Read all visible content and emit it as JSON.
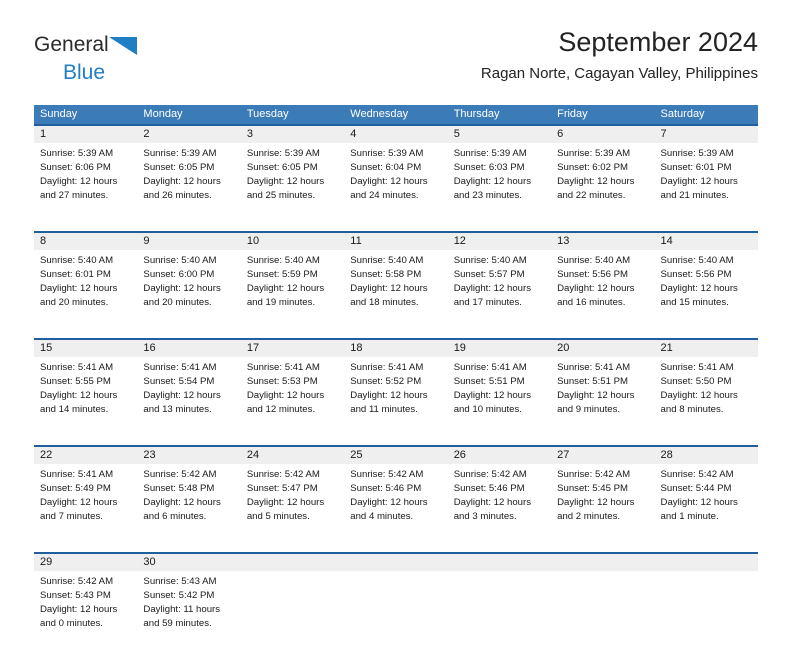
{
  "brand": {
    "name_part1": "General",
    "name_part2": "Blue",
    "triangle_icon": "blue-triangle-icon",
    "colors": {
      "text": "#2b2b2b",
      "blue": "#1f7ec4"
    }
  },
  "header": {
    "title": "September 2024",
    "subtitle": "Ragan Norte, Cagayan Valley, Philippines"
  },
  "theme": {
    "header_blue": "#3b7cb8",
    "separator_blue": "#1f5f9e",
    "daynum_band": "#efefef",
    "text": "#1a1a1a"
  },
  "weekdays": [
    "Sunday",
    "Monday",
    "Tuesday",
    "Wednesday",
    "Thursday",
    "Friday",
    "Saturday"
  ],
  "labels": {
    "sunrise_prefix": "Sunrise:",
    "sunset_prefix": "Sunset:",
    "daylight_prefix": "Daylight:"
  },
  "weeks": [
    {
      "days": [
        {
          "num": "1",
          "sunrise": "Sunrise: 5:39 AM",
          "sunset": "Sunset: 6:06 PM",
          "daylight_l1": "Daylight: 12 hours",
          "daylight_l2": "and 27 minutes."
        },
        {
          "num": "2",
          "sunrise": "Sunrise: 5:39 AM",
          "sunset": "Sunset: 6:05 PM",
          "daylight_l1": "Daylight: 12 hours",
          "daylight_l2": "and 26 minutes."
        },
        {
          "num": "3",
          "sunrise": "Sunrise: 5:39 AM",
          "sunset": "Sunset: 6:05 PM",
          "daylight_l1": "Daylight: 12 hours",
          "daylight_l2": "and 25 minutes."
        },
        {
          "num": "4",
          "sunrise": "Sunrise: 5:39 AM",
          "sunset": "Sunset: 6:04 PM",
          "daylight_l1": "Daylight: 12 hours",
          "daylight_l2": "and 24 minutes."
        },
        {
          "num": "5",
          "sunrise": "Sunrise: 5:39 AM",
          "sunset": "Sunset: 6:03 PM",
          "daylight_l1": "Daylight: 12 hours",
          "daylight_l2": "and 23 minutes."
        },
        {
          "num": "6",
          "sunrise": "Sunrise: 5:39 AM",
          "sunset": "Sunset: 6:02 PM",
          "daylight_l1": "Daylight: 12 hours",
          "daylight_l2": "and 22 minutes."
        },
        {
          "num": "7",
          "sunrise": "Sunrise: 5:39 AM",
          "sunset": "Sunset: 6:01 PM",
          "daylight_l1": "Daylight: 12 hours",
          "daylight_l2": "and 21 minutes."
        }
      ]
    },
    {
      "days": [
        {
          "num": "8",
          "sunrise": "Sunrise: 5:40 AM",
          "sunset": "Sunset: 6:01 PM",
          "daylight_l1": "Daylight: 12 hours",
          "daylight_l2": "and 20 minutes."
        },
        {
          "num": "9",
          "sunrise": "Sunrise: 5:40 AM",
          "sunset": "Sunset: 6:00 PM",
          "daylight_l1": "Daylight: 12 hours",
          "daylight_l2": "and 20 minutes."
        },
        {
          "num": "10",
          "sunrise": "Sunrise: 5:40 AM",
          "sunset": "Sunset: 5:59 PM",
          "daylight_l1": "Daylight: 12 hours",
          "daylight_l2": "and 19 minutes."
        },
        {
          "num": "11",
          "sunrise": "Sunrise: 5:40 AM",
          "sunset": "Sunset: 5:58 PM",
          "daylight_l1": "Daylight: 12 hours",
          "daylight_l2": "and 18 minutes."
        },
        {
          "num": "12",
          "sunrise": "Sunrise: 5:40 AM",
          "sunset": "Sunset: 5:57 PM",
          "daylight_l1": "Daylight: 12 hours",
          "daylight_l2": "and 17 minutes."
        },
        {
          "num": "13",
          "sunrise": "Sunrise: 5:40 AM",
          "sunset": "Sunset: 5:56 PM",
          "daylight_l1": "Daylight: 12 hours",
          "daylight_l2": "and 16 minutes."
        },
        {
          "num": "14",
          "sunrise": "Sunrise: 5:40 AM",
          "sunset": "Sunset: 5:56 PM",
          "daylight_l1": "Daylight: 12 hours",
          "daylight_l2": "and 15 minutes."
        }
      ]
    },
    {
      "days": [
        {
          "num": "15",
          "sunrise": "Sunrise: 5:41 AM",
          "sunset": "Sunset: 5:55 PM",
          "daylight_l1": "Daylight: 12 hours",
          "daylight_l2": "and 14 minutes."
        },
        {
          "num": "16",
          "sunrise": "Sunrise: 5:41 AM",
          "sunset": "Sunset: 5:54 PM",
          "daylight_l1": "Daylight: 12 hours",
          "daylight_l2": "and 13 minutes."
        },
        {
          "num": "17",
          "sunrise": "Sunrise: 5:41 AM",
          "sunset": "Sunset: 5:53 PM",
          "daylight_l1": "Daylight: 12 hours",
          "daylight_l2": "and 12 minutes."
        },
        {
          "num": "18",
          "sunrise": "Sunrise: 5:41 AM",
          "sunset": "Sunset: 5:52 PM",
          "daylight_l1": "Daylight: 12 hours",
          "daylight_l2": "and 11 minutes."
        },
        {
          "num": "19",
          "sunrise": "Sunrise: 5:41 AM",
          "sunset": "Sunset: 5:51 PM",
          "daylight_l1": "Daylight: 12 hours",
          "daylight_l2": "and 10 minutes."
        },
        {
          "num": "20",
          "sunrise": "Sunrise: 5:41 AM",
          "sunset": "Sunset: 5:51 PM",
          "daylight_l1": "Daylight: 12 hours",
          "daylight_l2": "and 9 minutes."
        },
        {
          "num": "21",
          "sunrise": "Sunrise: 5:41 AM",
          "sunset": "Sunset: 5:50 PM",
          "daylight_l1": "Daylight: 12 hours",
          "daylight_l2": "and 8 minutes."
        }
      ]
    },
    {
      "days": [
        {
          "num": "22",
          "sunrise": "Sunrise: 5:41 AM",
          "sunset": "Sunset: 5:49 PM",
          "daylight_l1": "Daylight: 12 hours",
          "daylight_l2": "and 7 minutes."
        },
        {
          "num": "23",
          "sunrise": "Sunrise: 5:42 AM",
          "sunset": "Sunset: 5:48 PM",
          "daylight_l1": "Daylight: 12 hours",
          "daylight_l2": "and 6 minutes."
        },
        {
          "num": "24",
          "sunrise": "Sunrise: 5:42 AM",
          "sunset": "Sunset: 5:47 PM",
          "daylight_l1": "Daylight: 12 hours",
          "daylight_l2": "and 5 minutes."
        },
        {
          "num": "25",
          "sunrise": "Sunrise: 5:42 AM",
          "sunset": "Sunset: 5:46 PM",
          "daylight_l1": "Daylight: 12 hours",
          "daylight_l2": "and 4 minutes."
        },
        {
          "num": "26",
          "sunrise": "Sunrise: 5:42 AM",
          "sunset": "Sunset: 5:46 PM",
          "daylight_l1": "Daylight: 12 hours",
          "daylight_l2": "and 3 minutes."
        },
        {
          "num": "27",
          "sunrise": "Sunrise: 5:42 AM",
          "sunset": "Sunset: 5:45 PM",
          "daylight_l1": "Daylight: 12 hours",
          "daylight_l2": "and 2 minutes."
        },
        {
          "num": "28",
          "sunrise": "Sunrise: 5:42 AM",
          "sunset": "Sunset: 5:44 PM",
          "daylight_l1": "Daylight: 12 hours",
          "daylight_l2": "and 1 minute."
        }
      ]
    },
    {
      "days": [
        {
          "num": "29",
          "sunrise": "Sunrise: 5:42 AM",
          "sunset": "Sunset: 5:43 PM",
          "daylight_l1": "Daylight: 12 hours",
          "daylight_l2": "and 0 minutes."
        },
        {
          "num": "30",
          "sunrise": "Sunrise: 5:43 AM",
          "sunset": "Sunset: 5:42 PM",
          "daylight_l1": "Daylight: 11 hours",
          "daylight_l2": "and 59 minutes."
        },
        {
          "num": "",
          "sunrise": "",
          "sunset": "",
          "daylight_l1": "",
          "daylight_l2": ""
        },
        {
          "num": "",
          "sunrise": "",
          "sunset": "",
          "daylight_l1": "",
          "daylight_l2": ""
        },
        {
          "num": "",
          "sunrise": "",
          "sunset": "",
          "daylight_l1": "",
          "daylight_l2": ""
        },
        {
          "num": "",
          "sunrise": "",
          "sunset": "",
          "daylight_l1": "",
          "daylight_l2": ""
        },
        {
          "num": "",
          "sunrise": "",
          "sunset": "",
          "daylight_l1": "",
          "daylight_l2": ""
        }
      ]
    }
  ]
}
